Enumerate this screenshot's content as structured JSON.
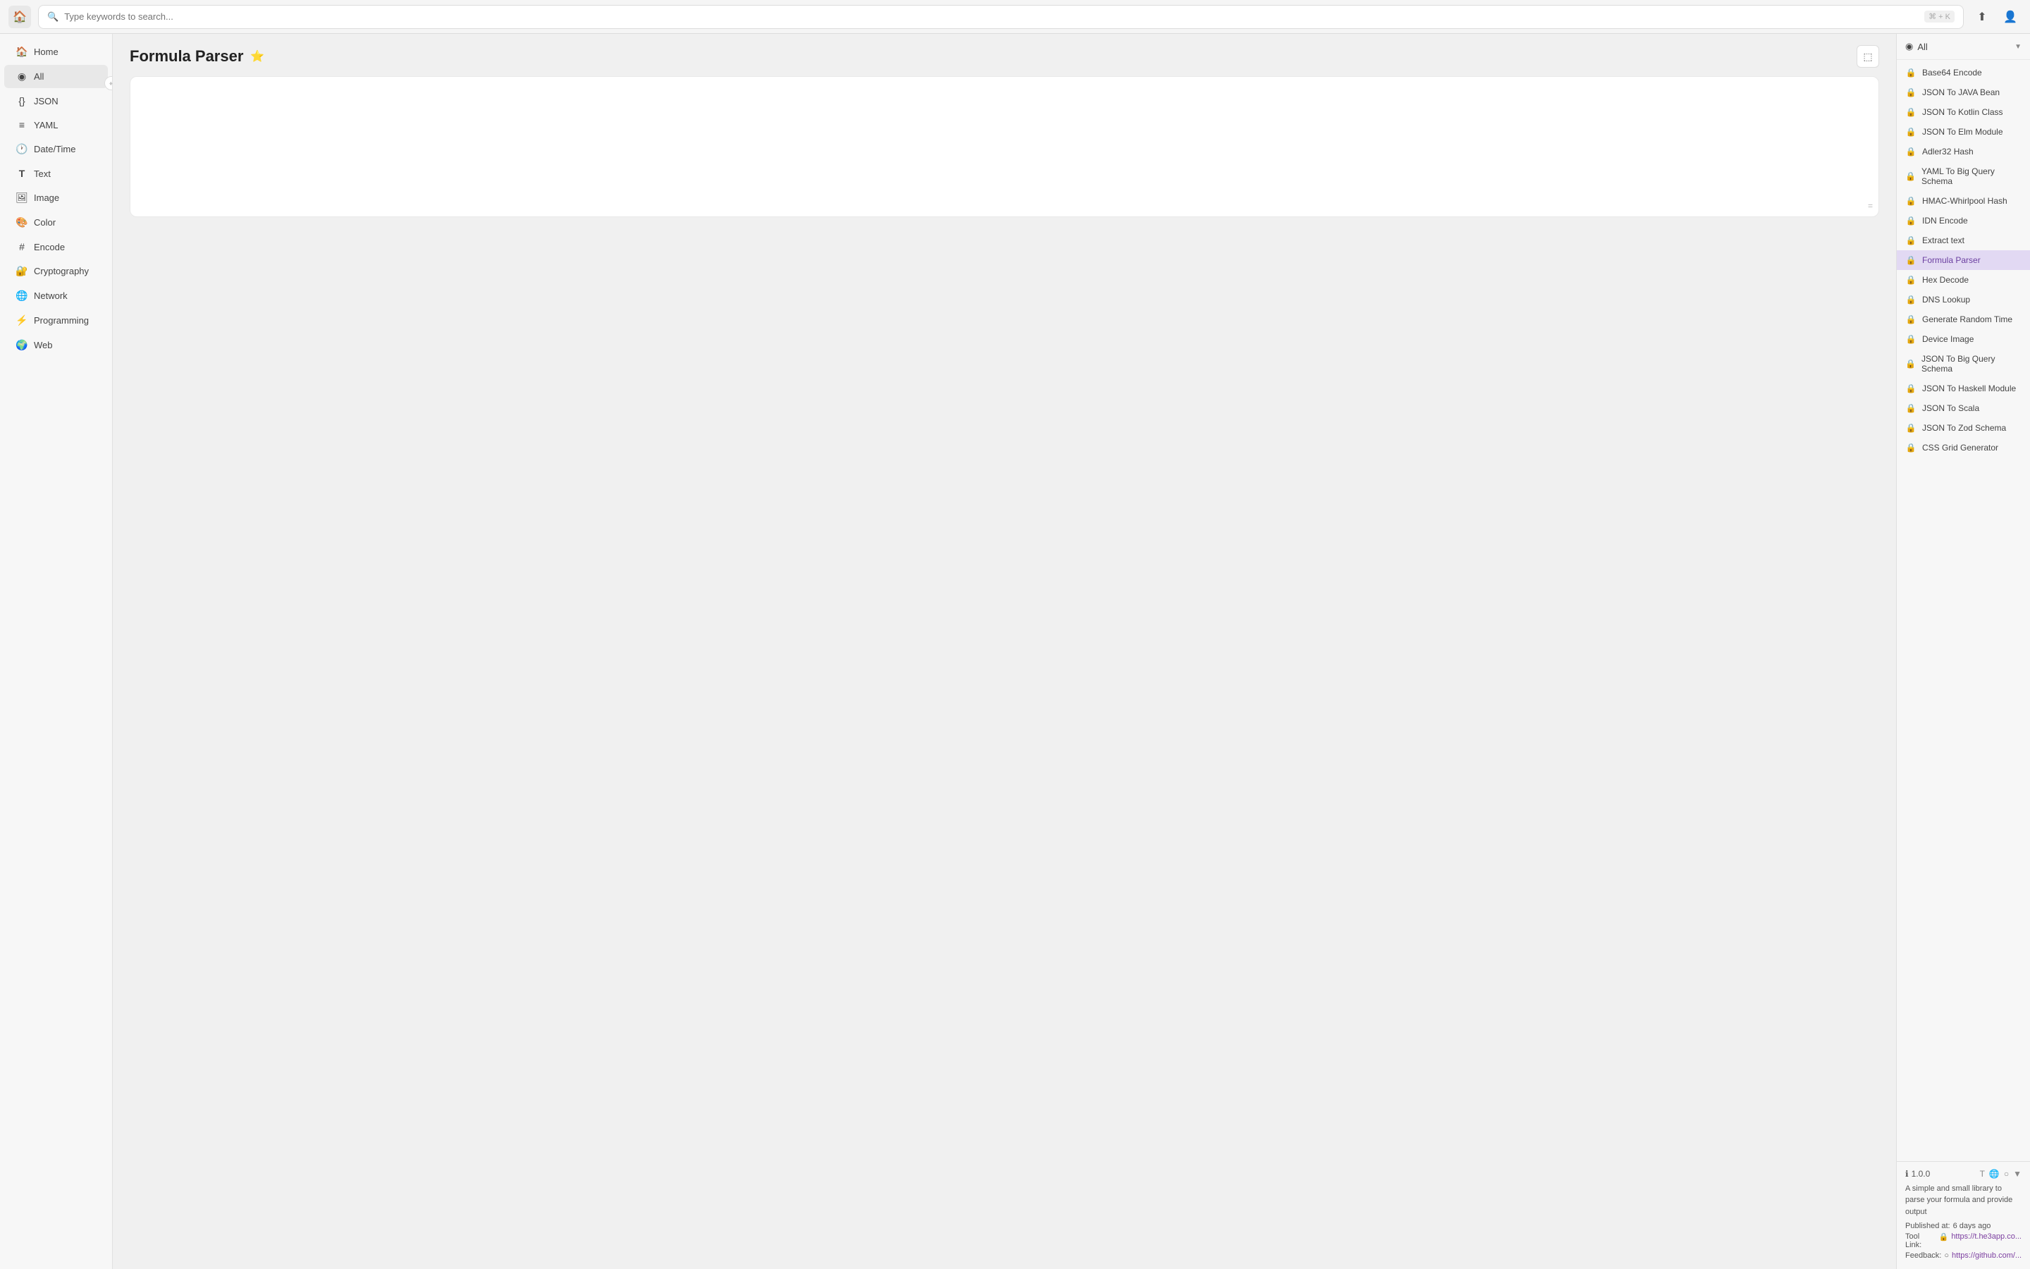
{
  "topbar": {
    "home_icon": "🏠",
    "search_placeholder": "Type keywords to search...",
    "search_shortcut": "⌘ + K",
    "share_icon": "⬆",
    "user_icon": "👤"
  },
  "sidebar": {
    "collapse_icon": "«",
    "items": [
      {
        "id": "home",
        "label": "Home",
        "icon": "🏠"
      },
      {
        "id": "all",
        "label": "All",
        "icon": "◉",
        "active": true
      },
      {
        "id": "json",
        "label": "JSON",
        "icon": "{}"
      },
      {
        "id": "yaml",
        "label": "YAML",
        "icon": "≡"
      },
      {
        "id": "datetime",
        "label": "Date/Time",
        "icon": "🕐"
      },
      {
        "id": "text",
        "label": "Text",
        "icon": "T"
      },
      {
        "id": "image",
        "label": "Image",
        "icon": "🖼"
      },
      {
        "id": "color",
        "label": "Color",
        "icon": "🎨"
      },
      {
        "id": "encode",
        "label": "Encode",
        "icon": "#"
      },
      {
        "id": "cryptography",
        "label": "Cryptography",
        "icon": "🔐"
      },
      {
        "id": "network",
        "label": "Network",
        "icon": "🌐"
      },
      {
        "id": "programming",
        "label": "Programming",
        "icon": "⚡"
      },
      {
        "id": "web",
        "label": "Web",
        "icon": "🌍"
      }
    ]
  },
  "page": {
    "title": "Formula Parser",
    "favorite_icon": "⭐"
  },
  "editor": {
    "placeholder": "",
    "resize_icon": "="
  },
  "right_panel": {
    "title": "All",
    "title_icon": "◉",
    "chevron": "▼",
    "items": [
      {
        "id": "base64-encode",
        "label": "Base64 Encode",
        "icon": "🔒"
      },
      {
        "id": "json-java",
        "label": "JSON To JAVA Bean",
        "icon": "🔒"
      },
      {
        "id": "json-kotlin",
        "label": "JSON To Kotlin Class",
        "icon": "🔒"
      },
      {
        "id": "json-elm",
        "label": "JSON To Elm Module",
        "icon": "🔒"
      },
      {
        "id": "adler32",
        "label": "Adler32 Hash",
        "icon": "🔒"
      },
      {
        "id": "yaml-bigquery",
        "label": "YAML To Big Query Schema",
        "icon": "🔒"
      },
      {
        "id": "hmac-whirlpool",
        "label": "HMAC-Whirlpool Hash",
        "icon": "🔒"
      },
      {
        "id": "idn-encode",
        "label": "IDN Encode",
        "icon": "🔒"
      },
      {
        "id": "extract-text",
        "label": "Extract text",
        "icon": "🔒"
      },
      {
        "id": "formula-parser",
        "label": "Formula Parser",
        "icon": "🔒",
        "active": true
      },
      {
        "id": "hex-decode",
        "label": "Hex Decode",
        "icon": "🔒"
      },
      {
        "id": "dns-lookup",
        "label": "DNS Lookup",
        "icon": "🔒"
      },
      {
        "id": "generate-random-time",
        "label": "Generate Random Time",
        "icon": "🔒"
      },
      {
        "id": "device-image",
        "label": "Device Image",
        "icon": "🔒"
      },
      {
        "id": "json-bigquery",
        "label": "JSON To Big Query Schema",
        "icon": "🔒"
      },
      {
        "id": "json-haskell",
        "label": "JSON To Haskell Module",
        "icon": "🔒"
      },
      {
        "id": "json-scala",
        "label": "JSON To Scala",
        "icon": "🔒"
      },
      {
        "id": "json-zod",
        "label": "JSON To Zod Schema",
        "icon": "🔒"
      },
      {
        "id": "css-grid",
        "label": "CSS Grid Generator",
        "icon": "🔒"
      }
    ]
  },
  "bottom_info": {
    "version": "1.0.0",
    "version_icon": "ℹ",
    "icons": [
      "T",
      "🌐",
      "○"
    ],
    "description": "A simple and small library to parse your formula and provide output",
    "published_label": "Published at:",
    "published_value": "6 days ago",
    "tool_link_label": "Tool Link:",
    "tool_link_icon": "🔒",
    "tool_link_text": "https://t.he3app.co...",
    "feedback_label": "Feedback:",
    "feedback_icon": "○",
    "feedback_text": "https://github.com/..."
  }
}
